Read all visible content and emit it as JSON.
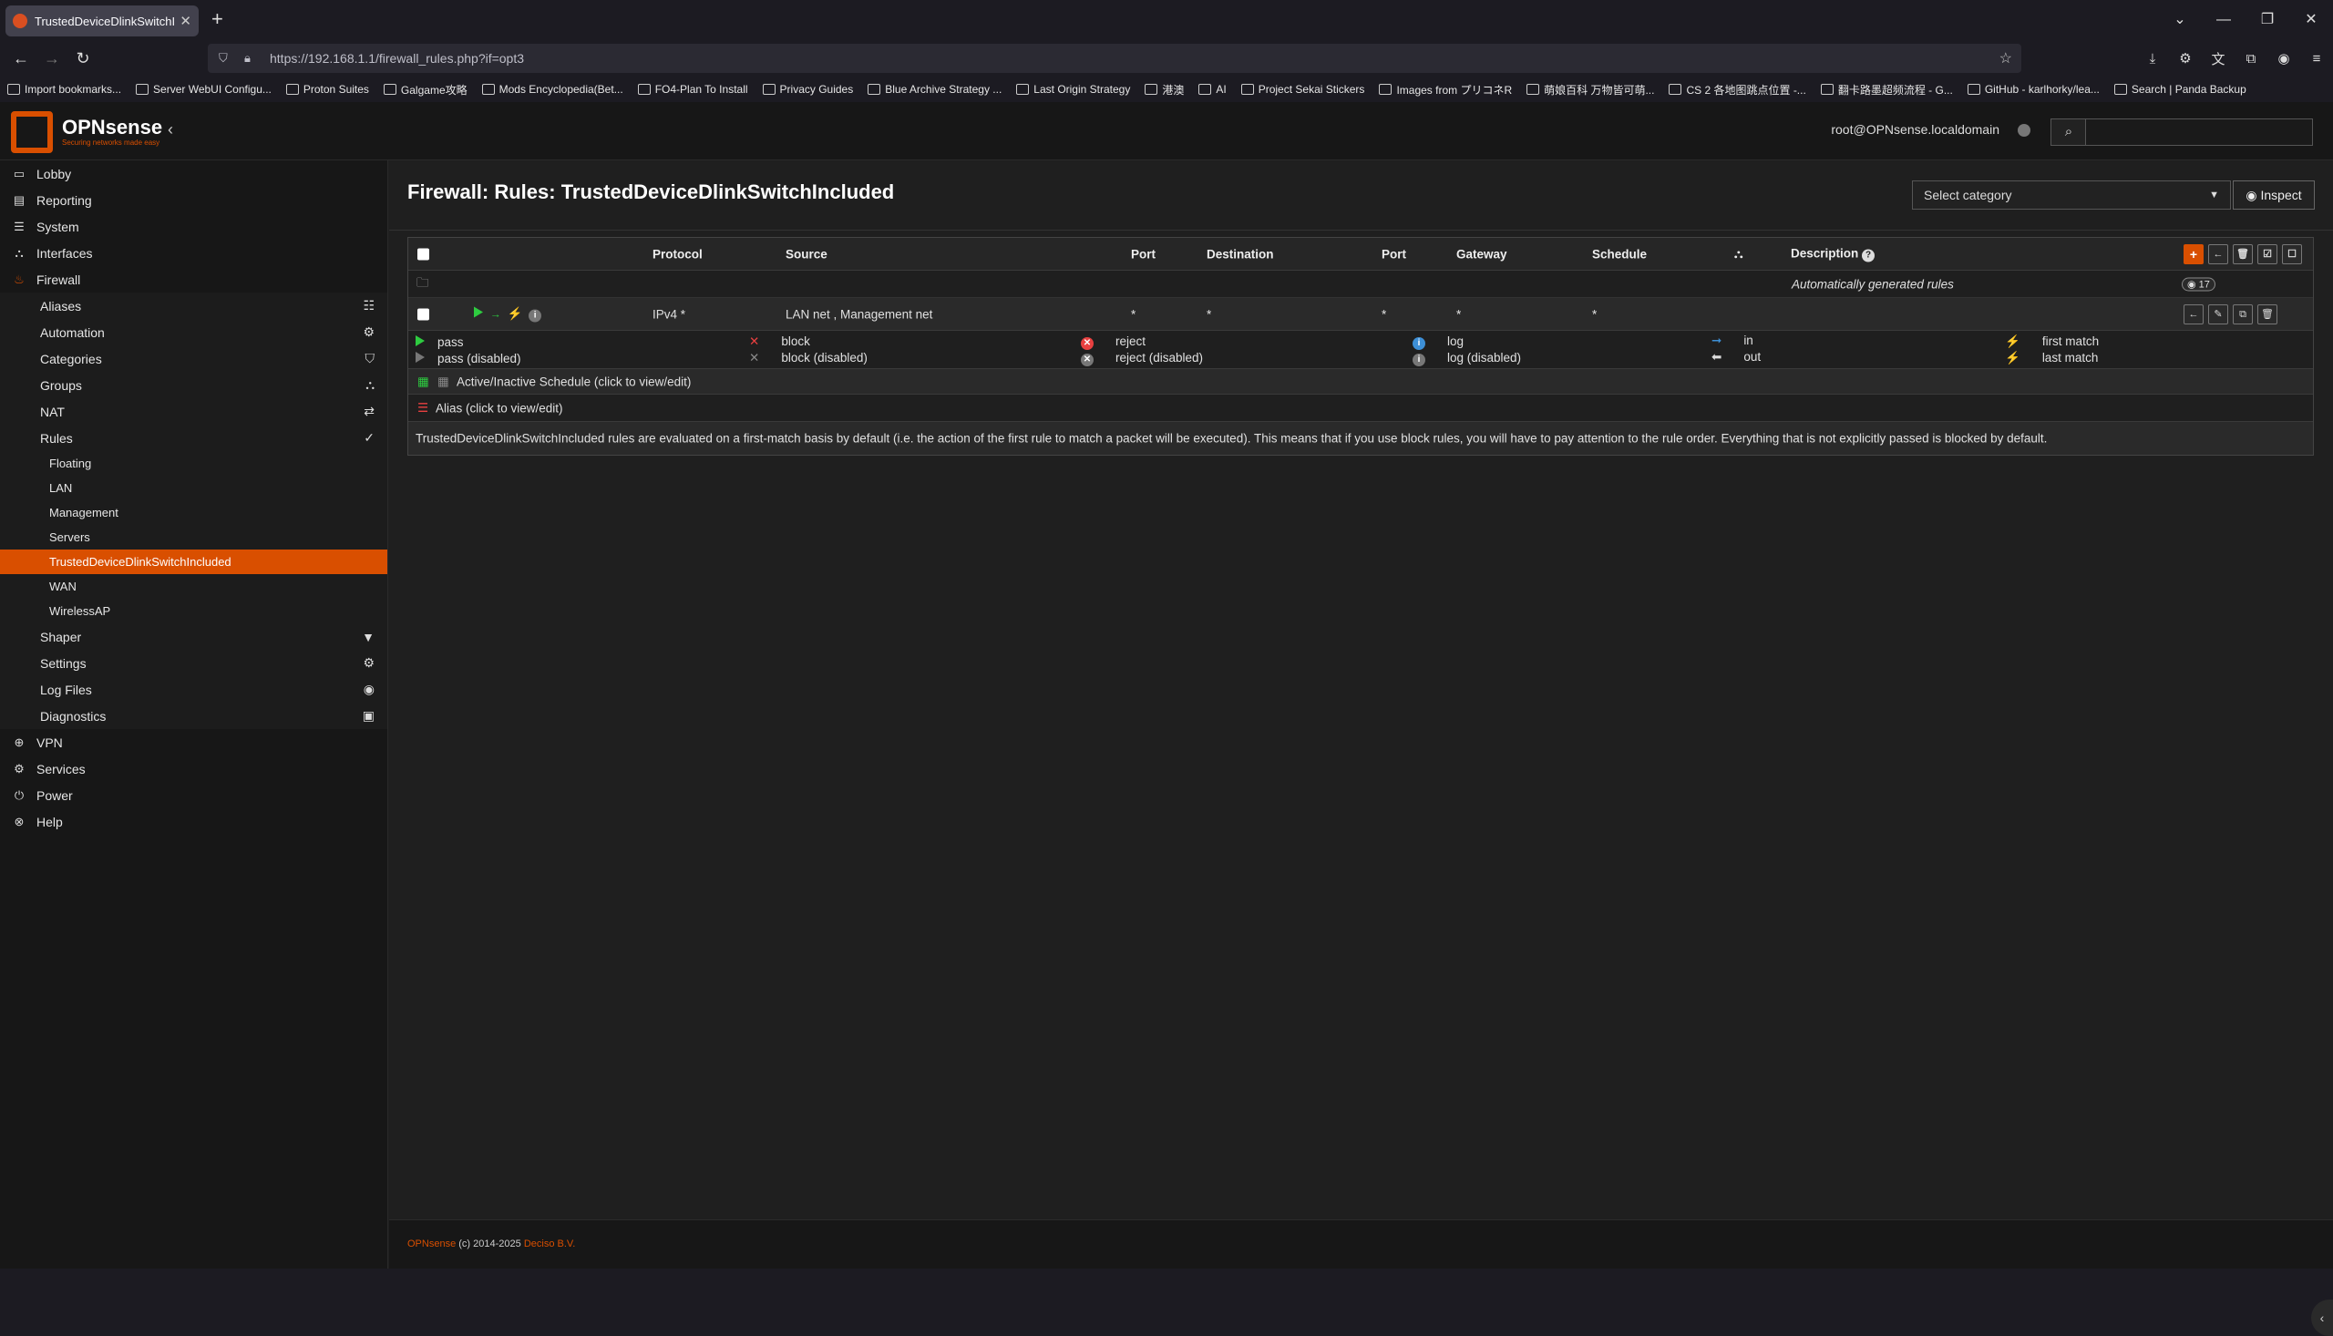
{
  "browser": {
    "tab_title": "TrustedDeviceDlinkSwitchInclu",
    "url": "https://192.168.1.1/firewall_rules.php?if=opt3",
    "bookmarks": [
      "Import bookmarks...",
      "Server WebUI Configu...",
      "Proton Suites",
      "Galgame攻略",
      "Mods Encyclopedia(Bet...",
      "FO4-Plan To Install",
      "Privacy Guides",
      "Blue Archive Strategy ...",
      "Last Origin Strategy",
      "港澳",
      "AI",
      "Project Sekai Stickers",
      "Images from プリコネR",
      "萌娘百科 万物皆可萌...",
      "CS 2 各地图跳点位置 -...",
      "翻卡路墨超频流程 - G...",
      "GitHub - karlhorky/lea...",
      "Search | Panda Backup"
    ]
  },
  "header": {
    "brand": "OPNsense",
    "tagline": "Securing networks made easy",
    "user": "root@OPNsense.localdomain"
  },
  "sidebar": {
    "top": [
      {
        "label": "Lobby"
      },
      {
        "label": "Reporting"
      },
      {
        "label": "System"
      },
      {
        "label": "Interfaces"
      },
      {
        "label": "Firewall"
      }
    ],
    "firewall_items": [
      {
        "label": "Aliases"
      },
      {
        "label": "Automation"
      },
      {
        "label": "Categories"
      },
      {
        "label": "Groups"
      },
      {
        "label": "NAT"
      },
      {
        "label": "Rules"
      }
    ],
    "rules_items": [
      {
        "label": "Floating"
      },
      {
        "label": "LAN"
      },
      {
        "label": "Management"
      },
      {
        "label": "Servers"
      },
      {
        "label": "TrustedDeviceDlinkSwitchIncluded"
      },
      {
        "label": "WAN"
      },
      {
        "label": "WirelessAP"
      }
    ],
    "firewall_more": [
      {
        "label": "Shaper"
      },
      {
        "label": "Settings"
      },
      {
        "label": "Log Files"
      },
      {
        "label": "Diagnostics"
      }
    ],
    "bottom": [
      {
        "label": "VPN"
      },
      {
        "label": "Services"
      },
      {
        "label": "Power"
      },
      {
        "label": "Help"
      }
    ]
  },
  "page": {
    "title": "Firewall: Rules: TrustedDeviceDlinkSwitchIncluded",
    "category_placeholder": "Select category",
    "inspect_label": "Inspect"
  },
  "table": {
    "headers": {
      "protocol": "Protocol",
      "source": "Source",
      "port": "Port",
      "destination": "Destination",
      "port2": "Port",
      "gateway": "Gateway",
      "schedule": "Schedule",
      "description": "Description"
    },
    "auto_rules_label": "Automatically generated rules",
    "auto_rules_count": "17",
    "rule": {
      "protocol": "IPv4 *",
      "source": "LAN net , Management net",
      "port": "*",
      "destination": "*",
      "port2": "*",
      "gateway": "*",
      "schedule": "*"
    }
  },
  "legend": {
    "pass": "pass",
    "pass_disabled": "pass (disabled)",
    "block": "block",
    "block_disabled": "block (disabled)",
    "reject": "reject",
    "reject_disabled": "reject (disabled)",
    "log": "log",
    "log_disabled": "log (disabled)",
    "in": "in",
    "out": "out",
    "first_match": "first match",
    "last_match": "last match",
    "schedule_label": "Active/Inactive Schedule (click to view/edit)",
    "alias_label": "Alias (click to view/edit)",
    "note": "TrustedDeviceDlinkSwitchIncluded rules are evaluated on a first-match basis by default (i.e. the action of the first rule to match a packet will be executed). This means that if you use block rules, you will have to pay attention to the rule order. Everything that is not explicitly passed is blocked by default."
  },
  "footer": {
    "brand": "OPNsense",
    "copyright": " (c) 2014-2025 ",
    "company": "Deciso B.V."
  },
  "colors": {
    "accent": "#d94f00",
    "pass": "#2ecc40",
    "block": "#e84040",
    "info": "#3d8fd6"
  }
}
